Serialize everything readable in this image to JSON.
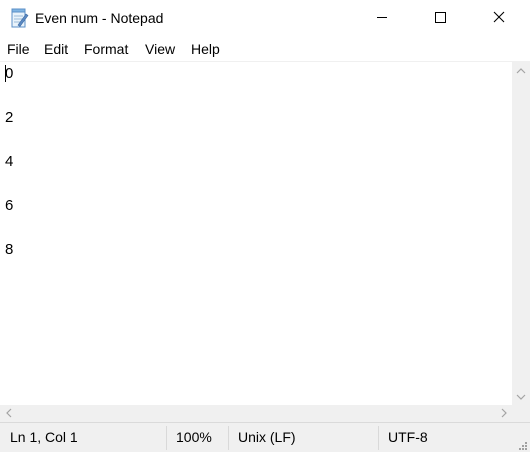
{
  "window": {
    "title": "Even num - Notepad",
    "icon": "notepad-icon",
    "controls": [
      "minimize-icon",
      "maximize-icon",
      "close-icon"
    ]
  },
  "menu": {
    "items": [
      "File",
      "Edit",
      "Format",
      "View",
      "Help"
    ]
  },
  "editor": {
    "lines": [
      "0",
      "2",
      "4",
      "6",
      "8"
    ]
  },
  "status": {
    "position": "Ln 1, Col 1",
    "zoom": "100%",
    "line_endings": "Unix (LF)",
    "encoding": "UTF-8"
  },
  "colors": {
    "chrome": "#f0f0f0",
    "text": "#000000",
    "background": "#ffffff"
  }
}
